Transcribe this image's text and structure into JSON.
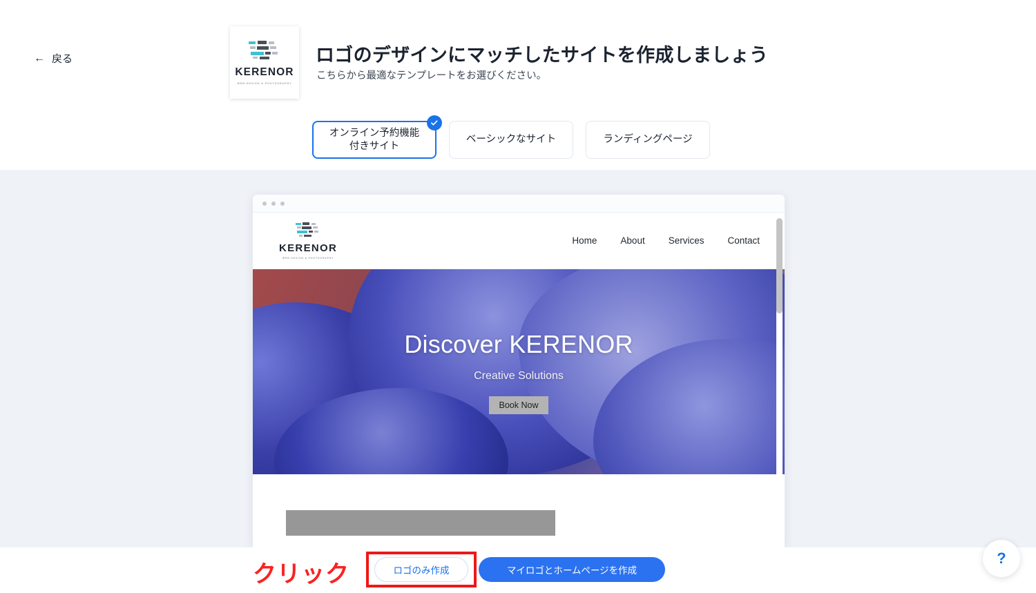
{
  "header": {
    "back_label": "戻る",
    "back_icon": "arrow-left-icon",
    "title": "ロゴのデザインにマッチしたサイトを作成しましょう",
    "subtitle": "こちらから最適なテンプレートをお選びください。",
    "logo": {
      "name": "KERENOR",
      "tagline": "WEB DESIGN & PHOTOGRAPHY",
      "mark_icon": "kerenor-bars-logo-icon"
    }
  },
  "tabs": [
    {
      "label": "オンライン予約機能 付きサイト",
      "line1": "オンライン予約機能",
      "line2": "付きサイト",
      "selected": true,
      "badge_icon": "check-circle-icon"
    },
    {
      "label": "ベーシックなサイト",
      "selected": false
    },
    {
      "label": "ランディングページ",
      "selected": false
    }
  ],
  "preview": {
    "window_dots": 3,
    "site": {
      "logo": {
        "name": "KERENOR",
        "tagline": "WEB DESIGN & PHOTOGRAPHY"
      },
      "nav": [
        "Home",
        "About",
        "Services",
        "Contact"
      ],
      "hero": {
        "title": "Discover KERENOR",
        "subtitle": "Creative Solutions",
        "cta": "Book Now"
      }
    },
    "scrollbar": "vertical-scrollbar"
  },
  "footer": {
    "annotation": "クリック",
    "secondary_button": "ロゴのみ作成",
    "primary_button": "マイロゴとホームページを作成",
    "help_icon": "question-mark-icon",
    "help_label": "?"
  },
  "colors": {
    "accent_blue": "#1a73e8",
    "primary_button": "#2b72f0",
    "annotation_red": "#fa2222",
    "highlight_red": "#f01717",
    "stage_bg": "#eff2f7",
    "logo_teal": "#3fc1cf",
    "logo_dark": "#4a4f57"
  }
}
